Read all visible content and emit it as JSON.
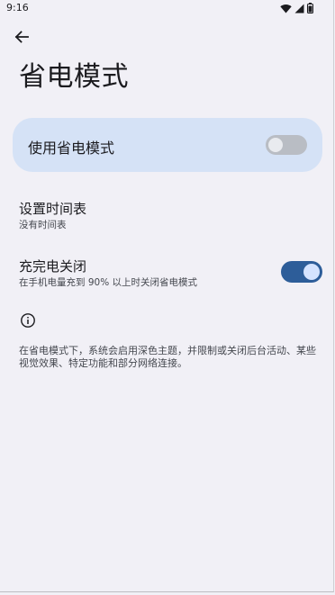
{
  "status_bar": {
    "time": "9:16",
    "icons": [
      "wifi-icon",
      "cellular-signal-icon",
      "battery-icon"
    ]
  },
  "header": {
    "back_icon": "arrow-left-icon",
    "title": "省电模式"
  },
  "main_toggle": {
    "label": "使用省电模式",
    "checked": false
  },
  "settings": {
    "schedule": {
      "title": "设置时间表",
      "subtitle": "没有时间表"
    },
    "charge_off": {
      "title": "充完电关闭",
      "subtitle": "在手机电量充到 90% 以上时关闭省电模式",
      "checked": true
    }
  },
  "info": {
    "icon": "info-icon",
    "text": "在省电模式下，系统会启用深色主题，并限制或关闭后台活动、某些视觉效果、特定功能和部分网络连接。"
  },
  "colors": {
    "background": "#f1f0f6",
    "card": "#d5e2f6",
    "switch_on_track": "#2d5d99",
    "switch_on_thumb": "#d5e3ff",
    "switch_off_track": "#b9bdc4"
  }
}
